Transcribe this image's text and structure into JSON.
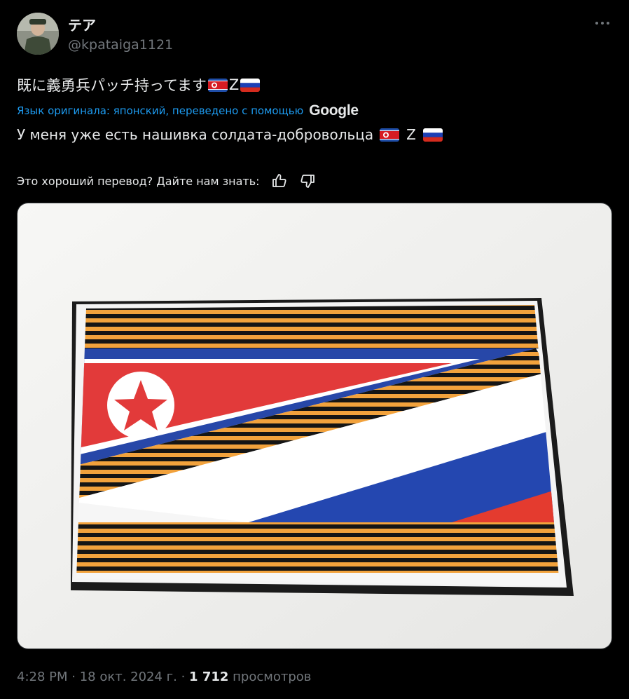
{
  "author": {
    "display_name": "テア",
    "handle": "@kpataiga1121"
  },
  "post": {
    "original_text": "既に義勇兵パッチ持ってます",
    "original_z": "Z",
    "translation_note": "Язык оригинала: японский, переведено с помощью",
    "translator_brand": "Google",
    "translated_text": "У меня уже есть нашивка солдата-добровольца",
    "translated_z": "Z",
    "feedback_prompt": "Это хороший перевод? Дайте нам знать:",
    "timestamp": "4:28 PM · 18 окт. 2024 г. ·",
    "views_count": "1 712",
    "views_label": "просмотров"
  },
  "icons": {
    "more": "more-horizontal-icon",
    "thumb_up": "thumbs-up-icon",
    "thumb_down": "thumbs-down-icon",
    "flag_kp": "north-korea-flag-icon",
    "flag_ru": "russia-flag-icon"
  },
  "colors": {
    "background": "#000000",
    "text_primary": "#e7e9ea",
    "text_secondary": "#71767b",
    "link": "#1d9bf0"
  }
}
